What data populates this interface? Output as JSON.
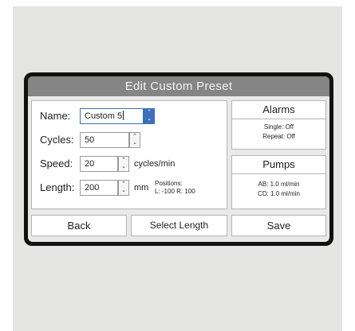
{
  "dialog": {
    "title": "Edit Custom Preset"
  },
  "fields": {
    "name": {
      "label": "Name:",
      "value": "Custom 5"
    },
    "cycles": {
      "label": "Cycles:",
      "value": "50"
    },
    "speed": {
      "label": "Speed:",
      "value": "20",
      "unit": "cycles/min"
    },
    "length": {
      "label": "Length:",
      "value": "200",
      "unit": "mm",
      "positions_label": "Positions:",
      "positions_values": "L: -100  R: 100"
    }
  },
  "alarms": {
    "title": "Alarms",
    "single": "Single: Off",
    "repeat": "Repeat: Off"
  },
  "pumps": {
    "title": "Pumps",
    "ab": "AB: 1.0 ml/min",
    "cd": "CD: 1.0 ml/min"
  },
  "buttons": {
    "back": "Back",
    "select_length": "Select Length",
    "save": "Save"
  },
  "icons": {
    "spin_up": "⌃",
    "spin_down": "⌄"
  },
  "colors": {
    "accent": "#3d6fba",
    "titlebar": "#858585",
    "bezel": "#111111"
  }
}
